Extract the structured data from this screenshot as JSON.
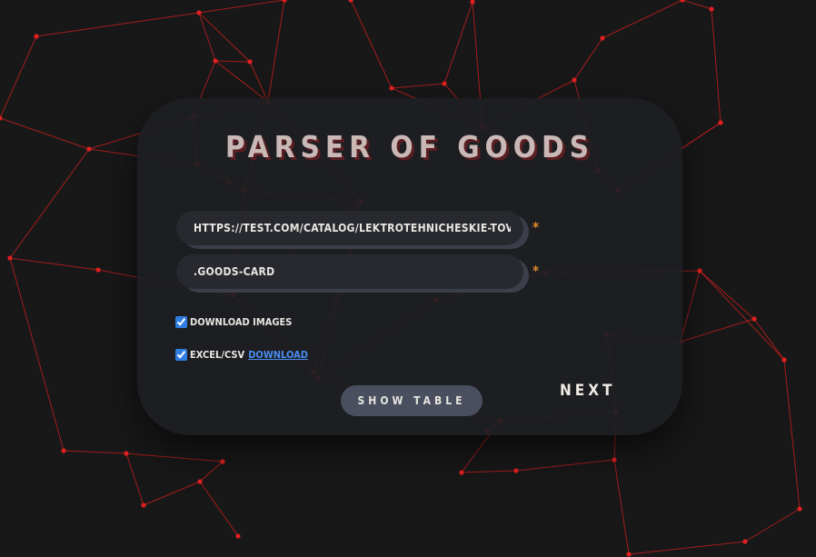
{
  "title": "PARSER OF GOODS",
  "url_field": {
    "value": "HTTPS://TEST.COM/CATALOG/LEKTROTEHNICHESKIE-TOVARI",
    "required_mark": "*"
  },
  "selector_field": {
    "value": ".GOODS-CARD",
    "required_mark": "*"
  },
  "options": {
    "download_images": {
      "label": "DOWNLOAD IMAGES",
      "checked": true
    },
    "excel_csv": {
      "label": "EXCEL/CSV",
      "link": "DOWNLOAD",
      "checked": true
    }
  },
  "buttons": {
    "show_table": "SHOW TABLE",
    "next": "NEXT"
  },
  "colors": {
    "background": "#181818",
    "network_line": "#e02020",
    "card": "#1e1f23",
    "accent_required": "#e0892a",
    "link": "#4a8cf0"
  }
}
